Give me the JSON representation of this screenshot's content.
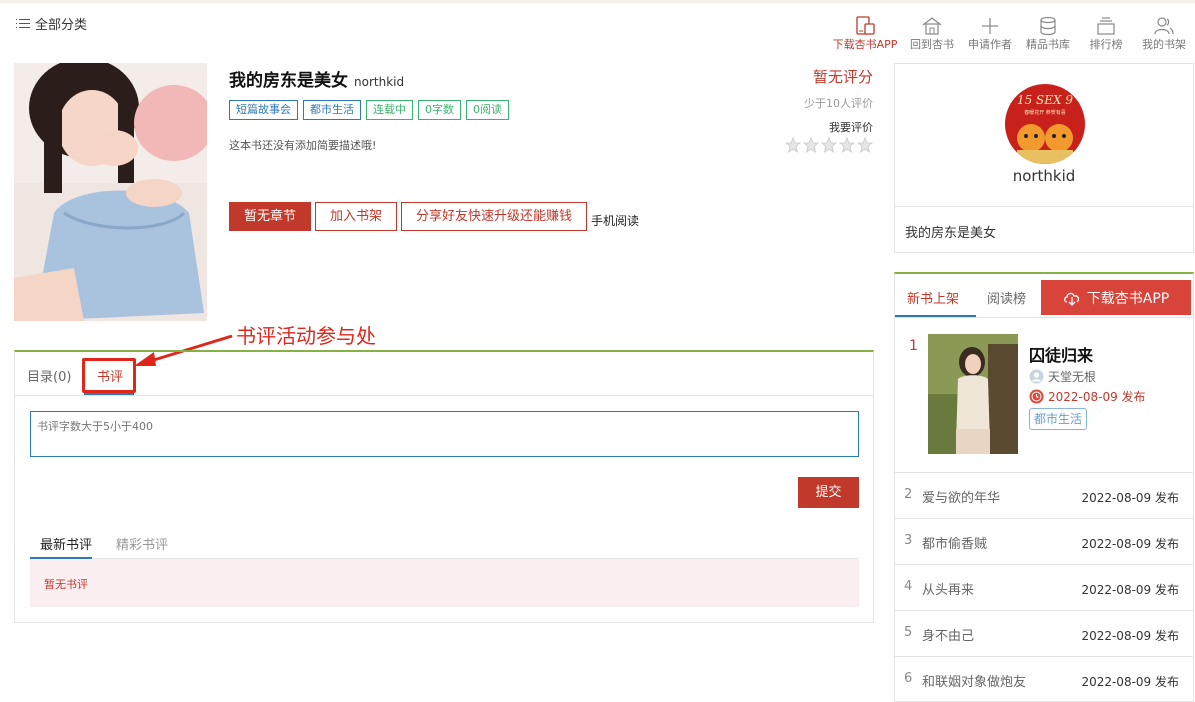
{
  "header": {
    "all_categories": "全部分类",
    "nav": [
      {
        "label": "下载杏书APP",
        "icon": "tablet-download-icon",
        "active": true
      },
      {
        "label": "回到杏书",
        "icon": "home-icon",
        "active": false
      },
      {
        "label": "申请作者",
        "icon": "plus-icon",
        "active": false
      },
      {
        "label": "精品书库",
        "icon": "database-icon",
        "active": false
      },
      {
        "label": "排行榜",
        "icon": "layers-icon",
        "active": false
      },
      {
        "label": "我的书架",
        "icon": "users-icon",
        "active": false
      }
    ]
  },
  "book": {
    "title": "我的房东是美女",
    "author": "northkid",
    "tags": [
      "短篇故事会",
      "都市生活",
      "连载中",
      "0字数",
      "0阅读"
    ],
    "description": "这本书还没有添加简要描述哦!",
    "rating": {
      "score_text": "暂无评分",
      "count_text": "少于10人评价",
      "rate_label": "我要评价",
      "stars": 5
    },
    "buttons": {
      "no_chapter": "暂无章节",
      "add_shelf": "加入书架",
      "share": "分享好友快速升级还能赚钱",
      "mobile_read": "手机阅读"
    }
  },
  "annotation": {
    "text": "书评活动参与处",
    "color": "#e0261b"
  },
  "panel": {
    "tabs": [
      "目录(0)",
      "书评"
    ],
    "active_tab": 1,
    "input_placeholder": "书评字数大于5小于400",
    "submit": "提交",
    "subtabs": [
      "最新书评",
      "精彩书评"
    ],
    "empty_text": "暂无书评"
  },
  "author_card": {
    "name": "northkid",
    "book": "我的房东是美女",
    "avatar_text": "15 SEX 9",
    "avatar_sub": "春暖花开 恭贺有喜"
  },
  "ranking": {
    "tabs": [
      "新书上架",
      "阅读榜"
    ],
    "download_btn": "下载杏书APP",
    "top": {
      "rank": "1",
      "title": "囚徒归来",
      "author": "天堂无根",
      "date": "2022-08-09 发布",
      "tag": "都市生活"
    },
    "items": [
      {
        "rank": "2",
        "title": "爱与欲的年华",
        "date": "2022-08-09 发布"
      },
      {
        "rank": "3",
        "title": "都市偷香贼",
        "date": "2022-08-09 发布"
      },
      {
        "rank": "4",
        "title": "从头再来",
        "date": "2022-08-09 发布"
      },
      {
        "rank": "5",
        "title": "身不由己",
        "date": "2022-08-09 发布"
      },
      {
        "rank": "6",
        "title": "和联姻对象做炮友",
        "date": "2022-08-09 发布"
      }
    ]
  },
  "colors": {
    "brand_red": "#c0392b",
    "link_blue": "#2e7ab8",
    "accent_green": "#86b243"
  }
}
